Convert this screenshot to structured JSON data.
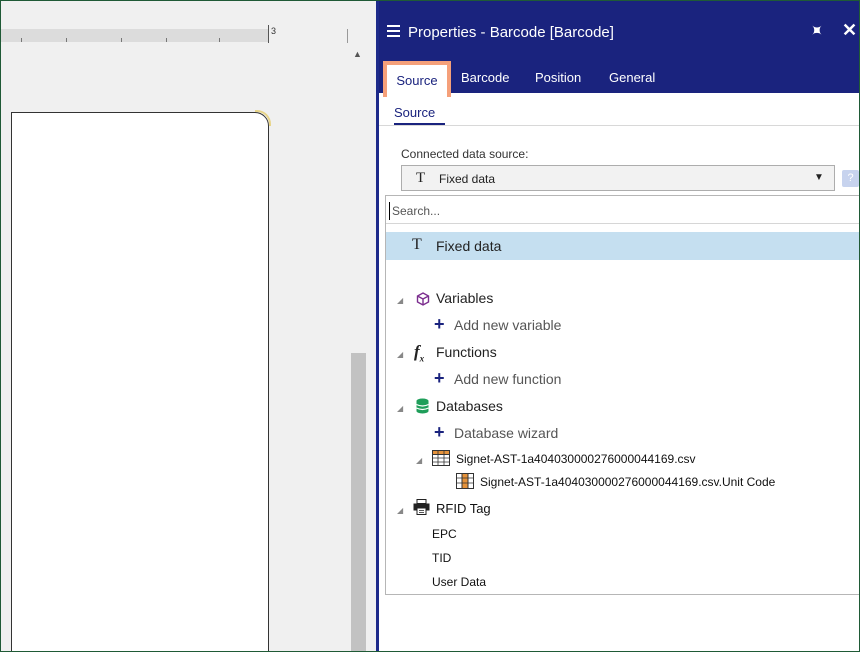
{
  "ruler": {
    "number": "3"
  },
  "panel": {
    "title": "Properties - Barcode [Barcode]",
    "tabs": [
      "Source",
      "Barcode",
      "Position",
      "General"
    ],
    "active_tab": "Source",
    "subtab": "Source"
  },
  "data_source": {
    "label": "Connected data source:",
    "selected": "Fixed data",
    "help": "?"
  },
  "dropdown": {
    "search_placeholder": "Search...",
    "fixed_data": "Fixed data",
    "variables": {
      "label": "Variables",
      "add": "Add new variable"
    },
    "functions": {
      "label": "Functions",
      "add": "Add new function"
    },
    "databases": {
      "label": "Databases",
      "add": "Database wizard",
      "file": "Signet-AST-1a404030000276000044169.csv",
      "field": "Signet-AST-1a404030000276000044169.csv.Unit Code"
    },
    "rfid": {
      "label": "RFID Tag",
      "items": [
        "EPC",
        "TID",
        "User Data"
      ]
    }
  },
  "colors": {
    "panel_header": "#1a237e",
    "selected_row": "#c5dff0",
    "highlight": "#f5a07a"
  }
}
